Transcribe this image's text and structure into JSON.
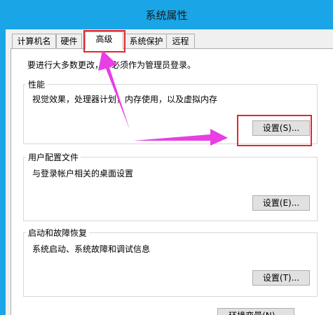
{
  "window": {
    "title": "系统属性"
  },
  "tabs": [
    {
      "label": "计算机名"
    },
    {
      "label": "硬件"
    },
    {
      "label": "高级"
    },
    {
      "label": "系统保护"
    },
    {
      "label": "远程"
    }
  ],
  "notice": "要进行大多数更改，你必须作为管理员登录。",
  "performance": {
    "title": "性能",
    "description": "视觉效果，处理器计划，内存使用，以及虚拟内存",
    "button": "设置(S)..."
  },
  "user_profiles": {
    "title": "用户配置文件",
    "description": "与登录帐户相关的桌面设置",
    "button": "设置(E)..."
  },
  "startup_recovery": {
    "title": "启动和故障恢复",
    "description": "系统启动、系统故障和调试信息",
    "button": "设置(T)..."
  },
  "env_button": "环境变量(N)...",
  "colors": {
    "titlebar": "#1aa5e6",
    "highlight": "#e3262e",
    "arrow": "#e83ee4"
  }
}
